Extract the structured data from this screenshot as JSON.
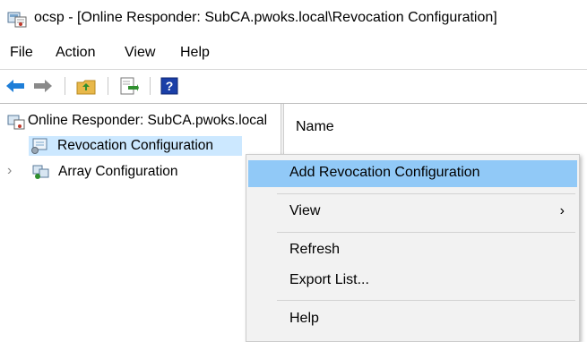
{
  "window": {
    "title": "ocsp - [Online Responder: SubCA.pwoks.local\\Revocation Configuration]",
    "icon": "online-responder-icon"
  },
  "menu": [
    "File",
    "Action",
    "View",
    "Help"
  ],
  "toolbar": {
    "buttons": [
      "back-arrow-icon",
      "forward-arrow-icon",
      "up-folder-icon",
      "export-list-icon",
      "help-icon"
    ]
  },
  "tree": {
    "root": "Online Responder: SubCA.pwoks.local",
    "items": [
      "Revocation Configuration",
      "Array Configuration"
    ]
  },
  "details": {
    "column_header": "Name"
  },
  "context_menu": {
    "items": [
      "Add Revocation Configuration",
      "View",
      "Refresh",
      "Export List...",
      "Help"
    ],
    "highlighted": "Add Revocation Configuration",
    "submenu_arrow": "›"
  },
  "colors": {
    "highlight": "#91c9f7",
    "selected": "#cce8ff",
    "menu_bg": "#f2f2f2"
  }
}
